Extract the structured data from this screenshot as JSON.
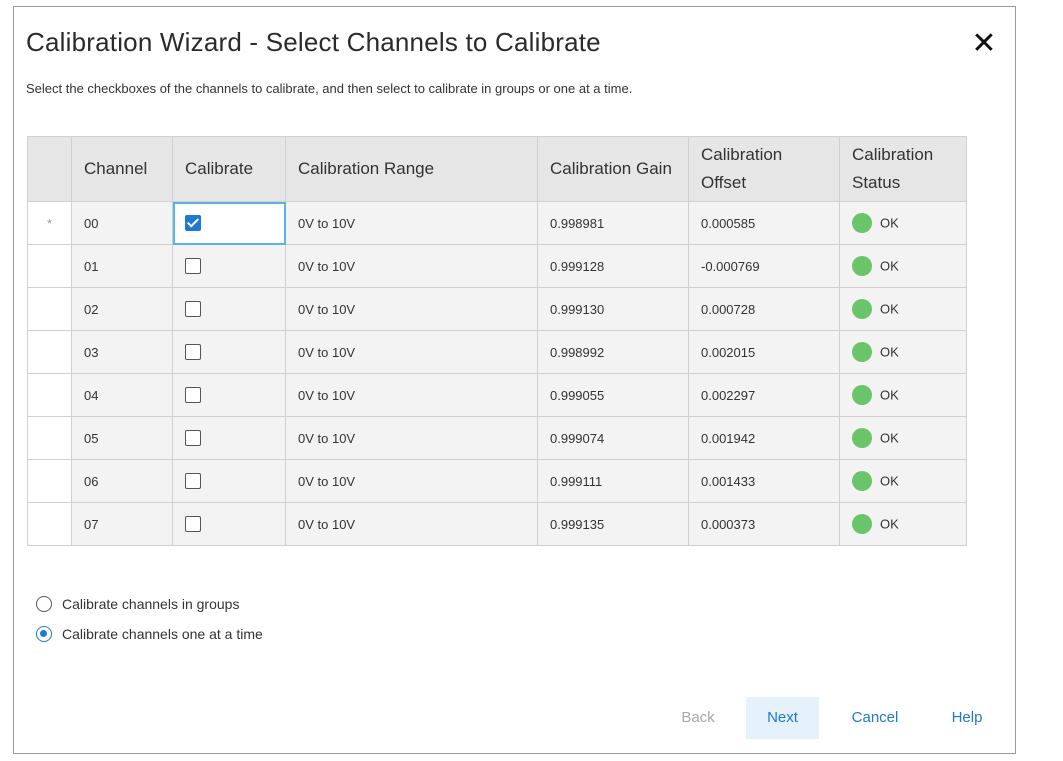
{
  "dialog": {
    "title": "Calibration Wizard - Select Channels to Calibrate",
    "subtitle": "Select the checkboxes of the channels to calibrate, and then select to calibrate in groups or one at a time.",
    "close_glyph": "✕"
  },
  "table": {
    "columns": {
      "channel": "Channel",
      "calibrate": "Calibrate",
      "range": "Calibration Range",
      "gain": "Calibration Gain",
      "offset": "Calibration Offset",
      "status": "Calibration Status"
    },
    "rows": [
      {
        "marker": "*",
        "channel": "00",
        "calibrate": true,
        "range": "0V to 10V",
        "gain": "0.998981",
        "offset": "0.000585",
        "status": "OK"
      },
      {
        "marker": "",
        "channel": "01",
        "calibrate": false,
        "range": "0V to 10V",
        "gain": "0.999128",
        "offset": "-0.000769",
        "status": "OK"
      },
      {
        "marker": "",
        "channel": "02",
        "calibrate": false,
        "range": "0V to 10V",
        "gain": "0.999130",
        "offset": "0.000728",
        "status": "OK"
      },
      {
        "marker": "",
        "channel": "03",
        "calibrate": false,
        "range": "0V to 10V",
        "gain": "0.998992",
        "offset": "0.002015",
        "status": "OK"
      },
      {
        "marker": "",
        "channel": "04",
        "calibrate": false,
        "range": "0V to 10V",
        "gain": "0.999055",
        "offset": "0.002297",
        "status": "OK"
      },
      {
        "marker": "",
        "channel": "05",
        "calibrate": false,
        "range": "0V to 10V",
        "gain": "0.999074",
        "offset": "0.001942",
        "status": "OK"
      },
      {
        "marker": "",
        "channel": "06",
        "calibrate": false,
        "range": "0V to 10V",
        "gain": "0.999111",
        "offset": "0.001433",
        "status": "OK"
      },
      {
        "marker": "",
        "channel": "07",
        "calibrate": false,
        "range": "0V to 10V",
        "gain": "0.999135",
        "offset": "0.000373",
        "status": "OK"
      }
    ],
    "status_color": "#6ac46a"
  },
  "mode": {
    "options": [
      {
        "label": "Calibrate channels in groups",
        "selected": false
      },
      {
        "label": "Calibrate channels one at a time",
        "selected": true
      }
    ]
  },
  "buttons": {
    "back": "Back",
    "next": "Next",
    "cancel": "Cancel",
    "help": "Help"
  },
  "colors": {
    "accent": "#1f78d1",
    "focus": "#58b3e8"
  }
}
